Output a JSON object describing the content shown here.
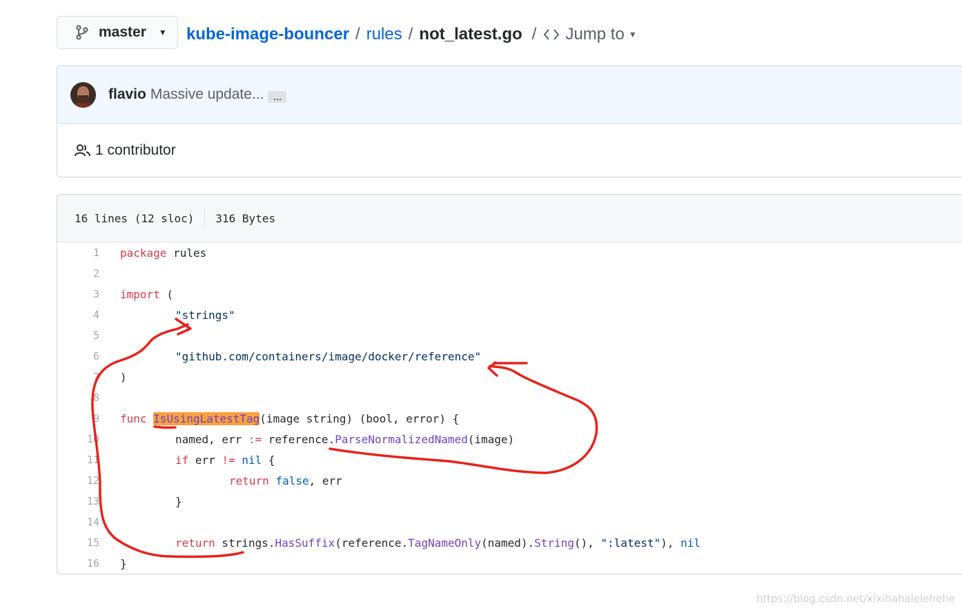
{
  "branch": {
    "icon": "git-branch-icon",
    "label": "master"
  },
  "breadcrumb": {
    "repo": "kube-image-bouncer",
    "sep": "/",
    "folder": "rules",
    "file": "not_latest.go",
    "jump_label": "Jump to",
    "jump_icon": "code-icon"
  },
  "commit": {
    "author": "flavio",
    "message": "Massive update...",
    "more_label": "…",
    "contributors_label": "1 contributor"
  },
  "file": {
    "lines_info": "16 lines (12 sloc)",
    "size_info": "316 Bytes"
  },
  "code": {
    "line_numbers": [
      "1",
      "2",
      "3",
      "4",
      "5",
      "6",
      "7",
      "8",
      "9",
      "10",
      "11",
      "12",
      "13",
      "14",
      "15",
      "16"
    ],
    "line1": {
      "kw": "package",
      "rest": " rules"
    },
    "line3": {
      "kw": "import",
      "rest": " ("
    },
    "line4": {
      "str": "\"strings\""
    },
    "line6": {
      "str": "\"github.com/containers/image/docker/reference\""
    },
    "line7": {
      "text": ")"
    },
    "line9": {
      "kw": "func",
      "name": "IsUsingLatestTag",
      "rest": "(image string) (bool, error) {"
    },
    "line10": {
      "a": "named, err ",
      "op": ":=",
      "b": " reference.",
      "fn": "ParseNormalizedNamed",
      "c": "(image)"
    },
    "line11": {
      "kw": "if",
      "a": " err ",
      "op": "!=",
      "sp": " ",
      "cn": "nil",
      "b": " {"
    },
    "line12": {
      "kw": "return",
      "sp": " ",
      "cn": "false",
      "b": ", err"
    },
    "line13": {
      "text": "}"
    },
    "line15": {
      "kw": "return",
      "a": " strings.",
      "fn1": "HasSuffix",
      "b": "(reference.",
      "fn2": "TagNameOnly",
      "c": "(named).",
      "fn3": "String",
      "d": "(), ",
      "str": "\":latest\"",
      "e": "), ",
      "cn": "nil"
    },
    "line16": {
      "text": "}"
    }
  },
  "watermark": "https://blog.csdn.net/xixihahalelehehe",
  "colors": {
    "link": "#0366d6",
    "keyword": "#d73a49",
    "string": "#032f62",
    "function": "#6f42c1",
    "constant": "#005cc5",
    "highlight": "#f9a03f",
    "annotation": "#e8221b"
  }
}
